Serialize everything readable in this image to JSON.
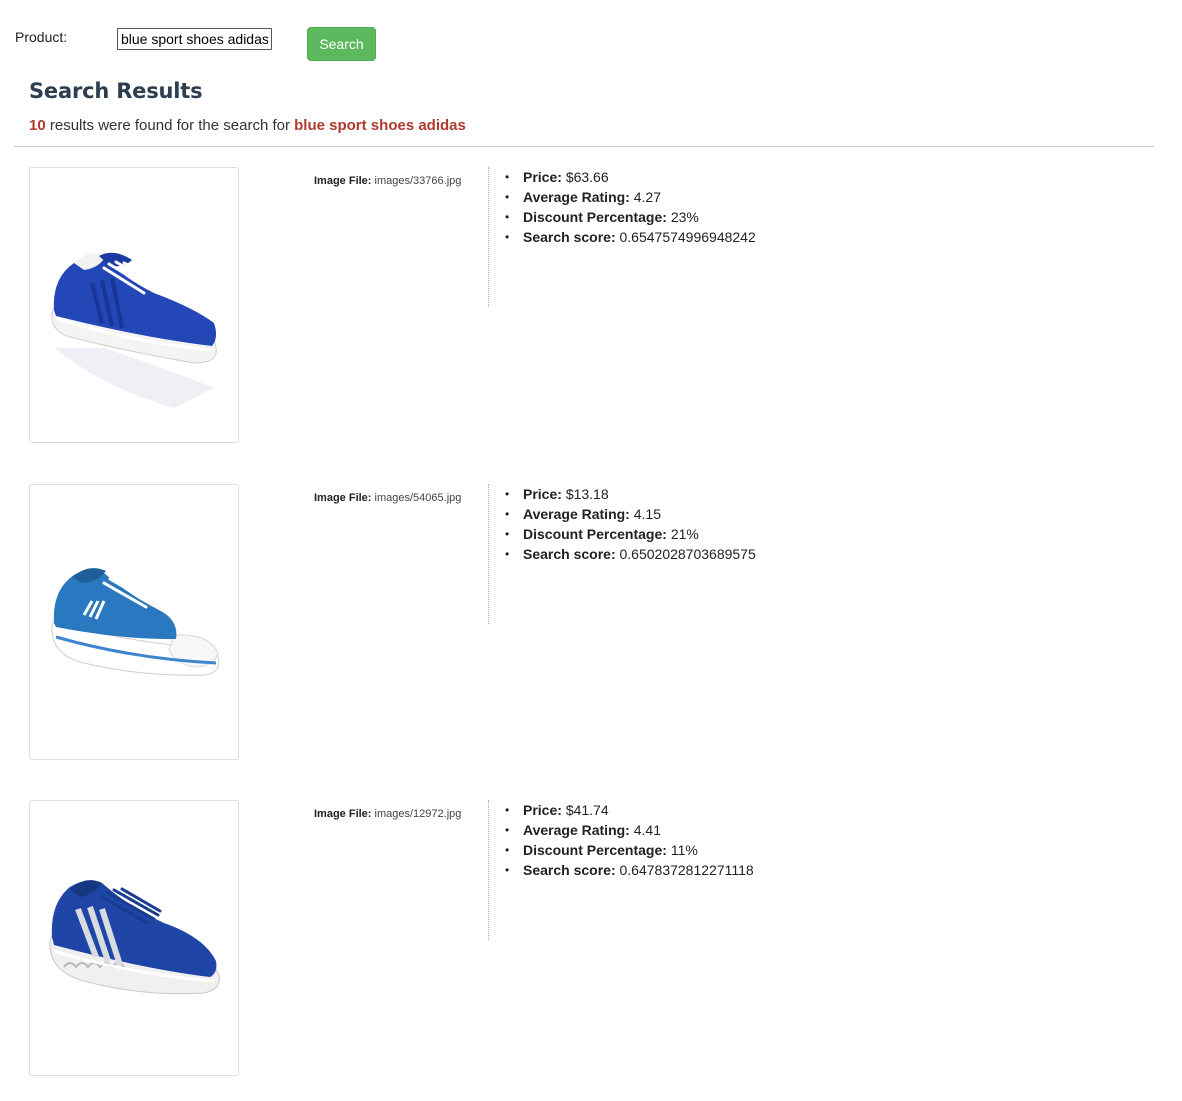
{
  "search": {
    "label": "Product:",
    "value": "blue sport shoes adidas",
    "button_label": "Search"
  },
  "results": {
    "title": "Search Results",
    "count": "10",
    "summary_middle": " results were found for the search for ",
    "query": "blue sport shoes adidas",
    "accent_color": "#b03a2e",
    "items": [
      {
        "image_label": "Image File:",
        "image_file": "images/33766.jpg",
        "image_icon": "blue-adidas-sneaker-photo",
        "price_label": "Price:",
        "price": "$63.66",
        "rating_label": "Average Rating:",
        "rating": "4.27",
        "discount_label": "Discount Percentage:",
        "discount": "23%",
        "score_label": "Search score:",
        "score": "0.6547574996948242"
      },
      {
        "image_label": "Image File:",
        "image_file": "images/54065.jpg",
        "image_icon": "blue-canvas-adidas-shoe-photo",
        "price_label": "Price:",
        "price": "$13.18",
        "rating_label": "Average Rating:",
        "rating": "4.15",
        "discount_label": "Discount Percentage:",
        "discount": "21%",
        "score_label": "Search score:",
        "score": "0.6502028703689575"
      },
      {
        "image_label": "Image File:",
        "image_file": "images/12972.jpg",
        "image_icon": "blue-adidas-running-shoe-photo",
        "price_label": "Price:",
        "price": "$41.74",
        "rating_label": "Average Rating:",
        "rating": "4.41",
        "discount_label": "Discount Percentage:",
        "discount": "11%",
        "score_label": "Search score:",
        "score": "0.6478372812271118"
      }
    ]
  },
  "colors": {
    "button_green": "#5cb85c",
    "title_color": "#2c3e50",
    "shoe_blue": "#2447b8"
  }
}
